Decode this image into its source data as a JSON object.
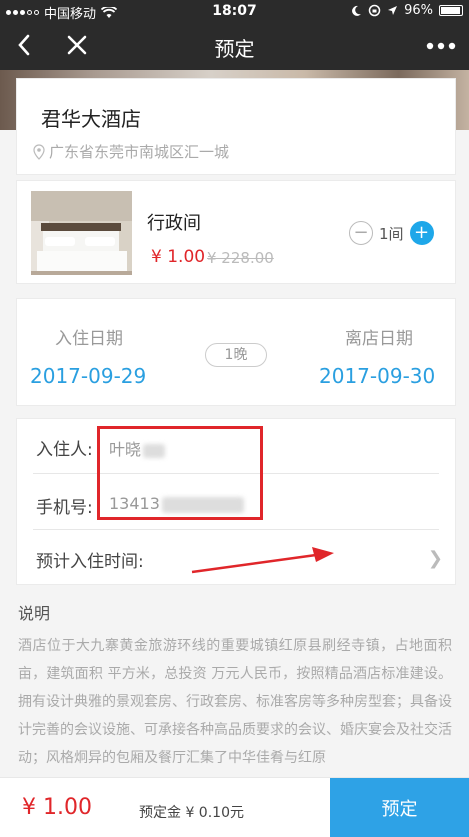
{
  "status_bar": {
    "carrier": "中国移动",
    "time": "18:07",
    "battery": "96%",
    "battery_level": 0.96
  },
  "nav": {
    "title": "预定"
  },
  "hotel": {
    "name": "君华大酒店",
    "address": "广东省东莞市南城区汇一城"
  },
  "room": {
    "name": "行政间",
    "price": "¥ 1.00",
    "original_price": "¥ 228.00",
    "quantity": "1间"
  },
  "dates": {
    "checkin_label": "入住日期",
    "checkin_value": "2017-09-29",
    "nights": "1晚",
    "checkout_label": "离店日期",
    "checkout_value": "2017-09-30"
  },
  "guest": {
    "name_label": "入住人:",
    "name_value": "叶晓",
    "phone_label": "手机号:",
    "phone_value": "13413",
    "arrival_label": "预计入住时间:"
  },
  "description": {
    "title": "说明",
    "text": "酒店位于大九寨黄金旅游环线的重要城镇红原县刷经寺镇，占地面积 亩，建筑面积 平方米，总投资 万元人民币，按照精品酒店标准建设。拥有设计典雅的景观套房、行政套房、标准客房等多种房型套；具备设计完善的会议设施、可承接各种高品质要求的会议、婚庆宴会及社交活动；风格炯异的包厢及餐厅汇集了中华佳肴与红原"
  },
  "bottom": {
    "total": "¥ 1.00",
    "deposit": "预定金 ¥ 0.10元",
    "book_label": "预定"
  },
  "colors": {
    "accent": "#2ea2e6",
    "price_red": "#e0262a",
    "nav_bg": "#2b2b2b"
  }
}
